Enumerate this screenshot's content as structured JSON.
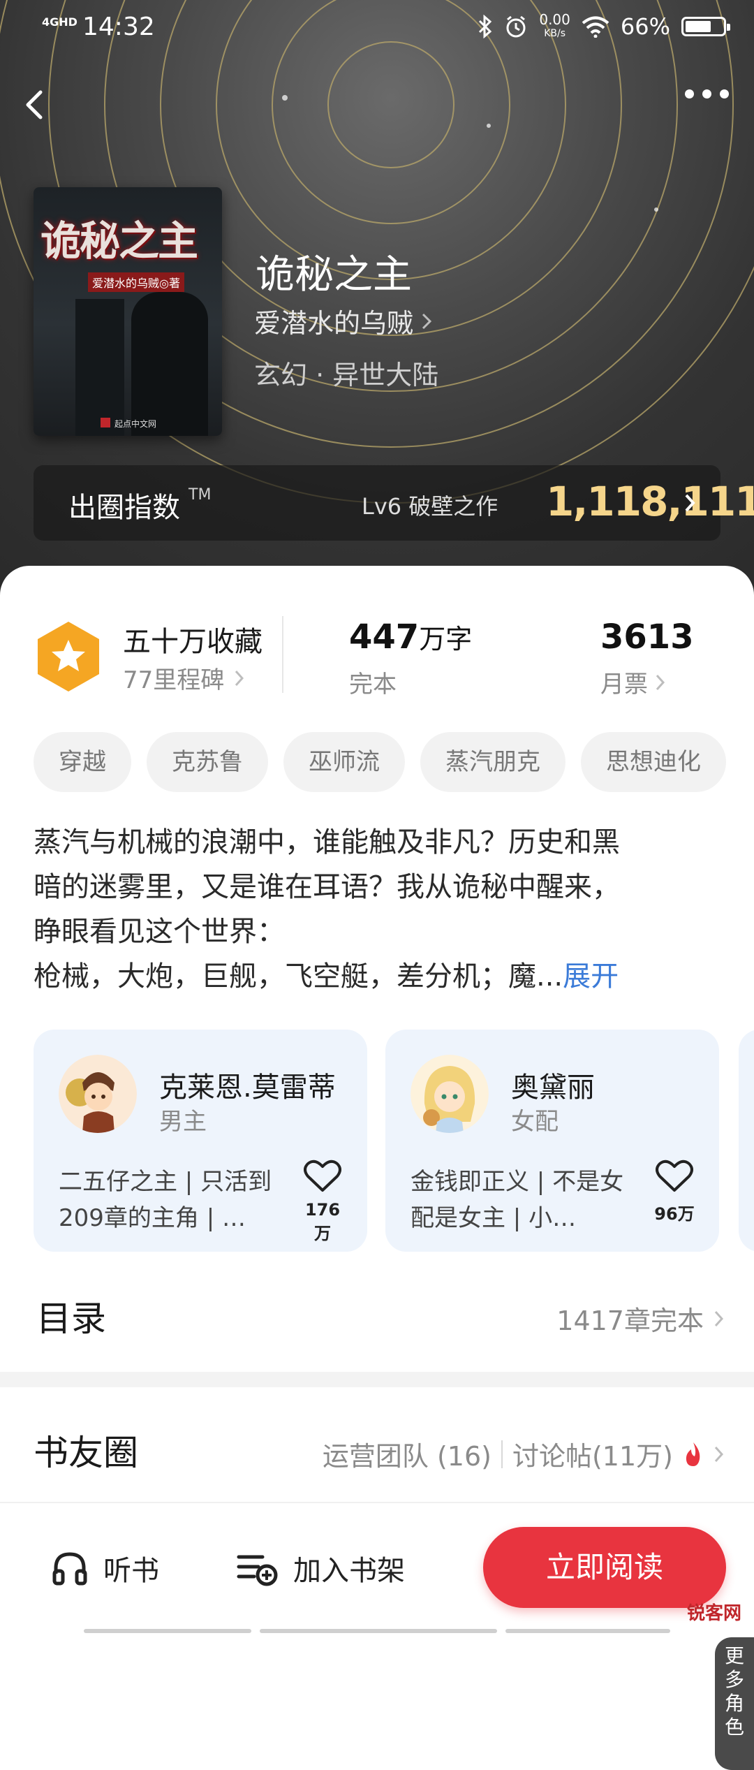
{
  "status_bar": {
    "signal": "4GHD",
    "time": "14:32",
    "net_speed_value": "0.00",
    "net_speed_unit": "KB/s",
    "battery": "66%"
  },
  "book": {
    "title": "诡秘之主",
    "author": "爱潜水的乌贼",
    "genre": "玄幻 · 异世大陆",
    "cover": {
      "title_text": "诡秘之主",
      "author_text": "爱潜水的乌贼◎著",
      "publisher_text": "起点中文网"
    }
  },
  "breakout_index": {
    "label": "出圈指数",
    "trademark": "TM",
    "level": "Lv6 破壁之作",
    "value": "1,118,111"
  },
  "stats": {
    "collection_title": "五十万收藏",
    "collection_sub": "77里程碑",
    "word_count": "447",
    "word_unit": "万字",
    "status": "完本",
    "monthly_votes": "3613",
    "monthly_votes_label": "月票"
  },
  "tags": [
    "穿越",
    "克苏鲁",
    "巫师流",
    "蒸汽朋克",
    "思想迪化"
  ],
  "synopsis": {
    "text_lines": [
      "蒸汽与机械的浪潮中，谁能触及非凡？历史和黑",
      "暗的迷雾里，又是谁在耳语？我从诡秘中醒来，",
      "睁眼看见这个世界："
    ],
    "last_line": "枪械，大炮，巨舰，飞空艇，差分机；魔...",
    "expand": "展开"
  },
  "characters": [
    {
      "name": "克莱恩.莫雷蒂",
      "role": "男主",
      "desc": "二五仔之主 | 只活到209章的主角 | …",
      "likes": "176万"
    },
    {
      "name": "奥黛丽",
      "role": "女配",
      "desc": "金钱即正义 | 不是女配是女主 | 小…",
      "likes": "96万"
    }
  ],
  "more_roles": "更多角色",
  "toc": {
    "title": "目录",
    "summary": "1417章完本"
  },
  "community": {
    "title": "书友圈",
    "team": "运营团队 (16)",
    "posts": "讨论帖(11万)"
  },
  "bottom_bar": {
    "listen": "听书",
    "shelf": "加入书架",
    "read": "立即阅读"
  },
  "watermark": "锐客网",
  "colors": {
    "accent_red": "#e8343f",
    "gold": "#f5d58b",
    "link_blue": "#3b7bd8",
    "badge_orange": "#f5a623"
  }
}
